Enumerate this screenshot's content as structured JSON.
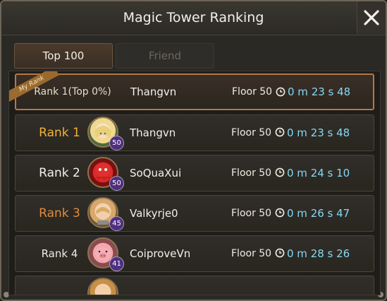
{
  "window": {
    "title": "Magic Tower Ranking",
    "close_icon": "close-icon"
  },
  "tabs": [
    {
      "label": "Top 100",
      "active": true
    },
    {
      "label": "Friend",
      "active": false
    }
  ],
  "my_rank": {
    "badge": "My Rank",
    "rank": "Rank 1(Top 0%)",
    "name": "Thangvn",
    "floor": "Floor 50",
    "time": "0 m 23 s 48"
  },
  "rows": [
    {
      "rank": "Rank 1",
      "name": "Thangvn",
      "level": "50",
      "floor": "Floor 50",
      "time": "0 m 23 s 48",
      "rank_color": "#f0b23a"
    },
    {
      "rank": "Rank 2",
      "name": "SoQuaXui",
      "level": "50",
      "floor": "Floor 50",
      "time": "0 m 24 s 10",
      "rank_color": "#f3efe8"
    },
    {
      "rank": "Rank 3",
      "name": "Valkyrje0",
      "level": "45",
      "floor": "Floor 50",
      "time": "0 m 26 s 47",
      "rank_color": "#e28a3c"
    },
    {
      "rank": "Rank 4",
      "name": "CoiproveVn",
      "level": "41",
      "floor": "Floor 50",
      "time": "0 m 28 s 26",
      "rank_color": "#efeae1"
    }
  ]
}
